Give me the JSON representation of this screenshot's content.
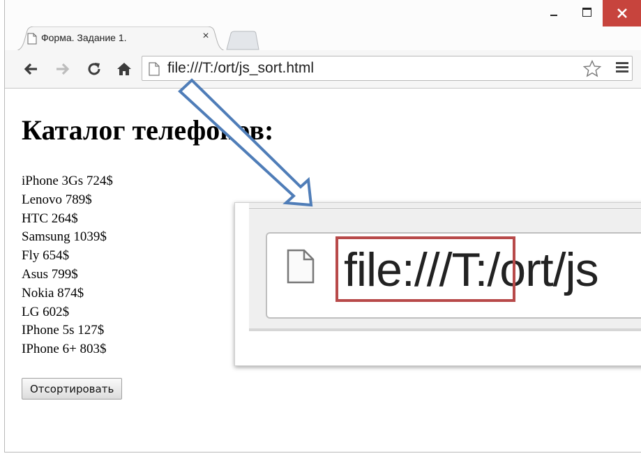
{
  "browser": {
    "tab_title": "Форма. Задание 1.",
    "tab_close": "×",
    "url": "file:///T:/ort/js_sort.html"
  },
  "icons": {
    "back": "back-arrow-icon",
    "forward": "forward-arrow-icon",
    "reload": "reload-icon",
    "home": "home-icon",
    "page": "page-icon",
    "star": "star-icon",
    "menu": "menu-icon"
  },
  "page": {
    "title": "Каталог телефонов:",
    "phones": [
      "iPhone 3Gs 724$",
      "Lenovo 789$",
      "HTC 264$",
      "Samsung 1039$",
      "Fly 654$",
      "Asus 799$",
      "Nokia 874$",
      "LG 602$",
      "IPhone 5s 127$",
      "IPhone 6+ 803$"
    ],
    "sort_button": "Отсортировать"
  },
  "callout": {
    "url_fragment": "file:///T:/ort/js"
  },
  "colors": {
    "close_button": "#c7443d",
    "highlight_rect": "#b84a4a",
    "arrow": "#4f7db8"
  }
}
